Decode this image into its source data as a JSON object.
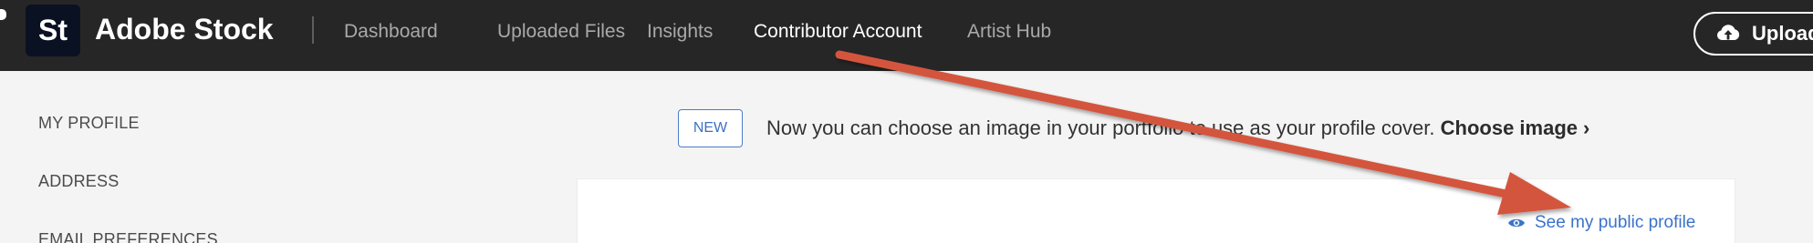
{
  "header": {
    "logo_text": "St",
    "brand": "Adobe Stock",
    "nav": [
      {
        "label": "Dashboard",
        "active": false
      },
      {
        "label": "Uploaded Files",
        "active": false
      },
      {
        "label": "Insights",
        "active": false
      },
      {
        "label": "Contributor Account",
        "active": true
      },
      {
        "label": "Artist Hub",
        "active": false
      }
    ],
    "upload_label": "Upload",
    "upload_icon": "cloud-upload-icon"
  },
  "sidebar": {
    "items": [
      {
        "label": "MY PROFILE"
      },
      {
        "label": "ADDRESS"
      },
      {
        "label": "EMAIL PREFERENCES"
      }
    ]
  },
  "banner": {
    "badge": "NEW",
    "text": "Now you can choose an image in your portfolio to use as your profile cover.",
    "link": "Choose image",
    "chevron": "›"
  },
  "card": {
    "profile_link": "See my public profile",
    "profile_link_icon": "eye-icon"
  },
  "annotation": {
    "type": "arrow",
    "color": "#d4543c",
    "from": "Contributor Account",
    "to": "See my public profile"
  },
  "colors": {
    "topbar": "#262626",
    "page_bg": "#f4f4f4",
    "link_blue": "#3a73c9",
    "arrow": "#d4543c"
  }
}
